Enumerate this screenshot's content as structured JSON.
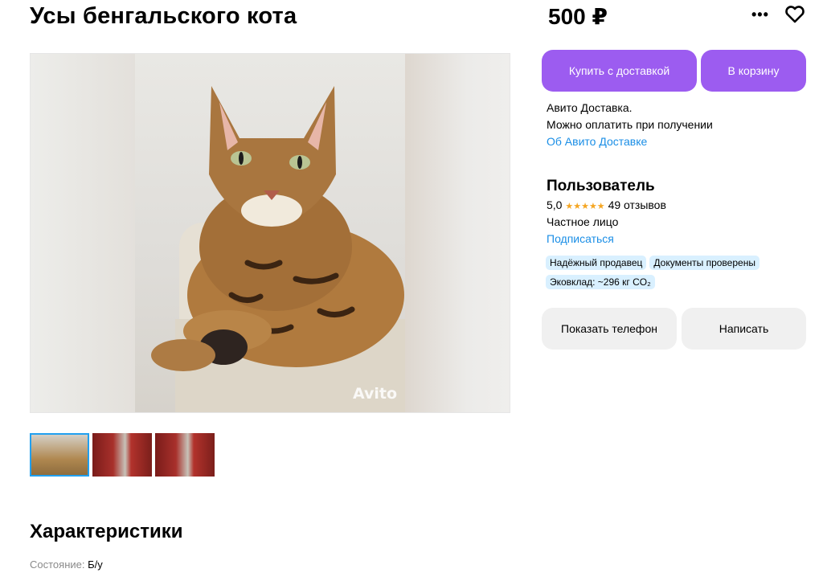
{
  "listing": {
    "title": "Усы бенгальского кота",
    "price": "500 ₽"
  },
  "gallery": {
    "watermark": "Avito",
    "thumbnails": [
      {
        "description_icon": "cat-photo"
      },
      {
        "description_icon": "whiskers-photo"
      },
      {
        "description_icon": "whiskers-photo"
      }
    ]
  },
  "actions": {
    "buy_with_delivery": "Купить с доставкой",
    "add_to_cart": "В корзину",
    "show_phone": "Показать телефон",
    "write": "Написать"
  },
  "delivery": {
    "line1": "Авито Доставка.",
    "line2": "Можно оплатить при получении",
    "link": "Об Авито Доставке"
  },
  "seller": {
    "name": "Пользователь",
    "rating": "5,0",
    "stars": "★★★★★",
    "reviews": "49 отзывов",
    "type": "Частное лицо",
    "subscribe": "Подписаться",
    "badges": [
      "Надёжный продавец",
      "Документы проверены",
      "Эковклад: ~296 кг CO₂"
    ]
  },
  "specs": {
    "title": "Характеристики",
    "condition_label": "Состояние:",
    "condition_value": "Б/у"
  },
  "icons": {
    "more": "more-icon",
    "favorite": "heart-icon"
  },
  "colors": {
    "accent": "#9c5cf0",
    "link": "#1a8ee6",
    "badge_bg": "#d9f0ff",
    "star": "#f5a623"
  }
}
